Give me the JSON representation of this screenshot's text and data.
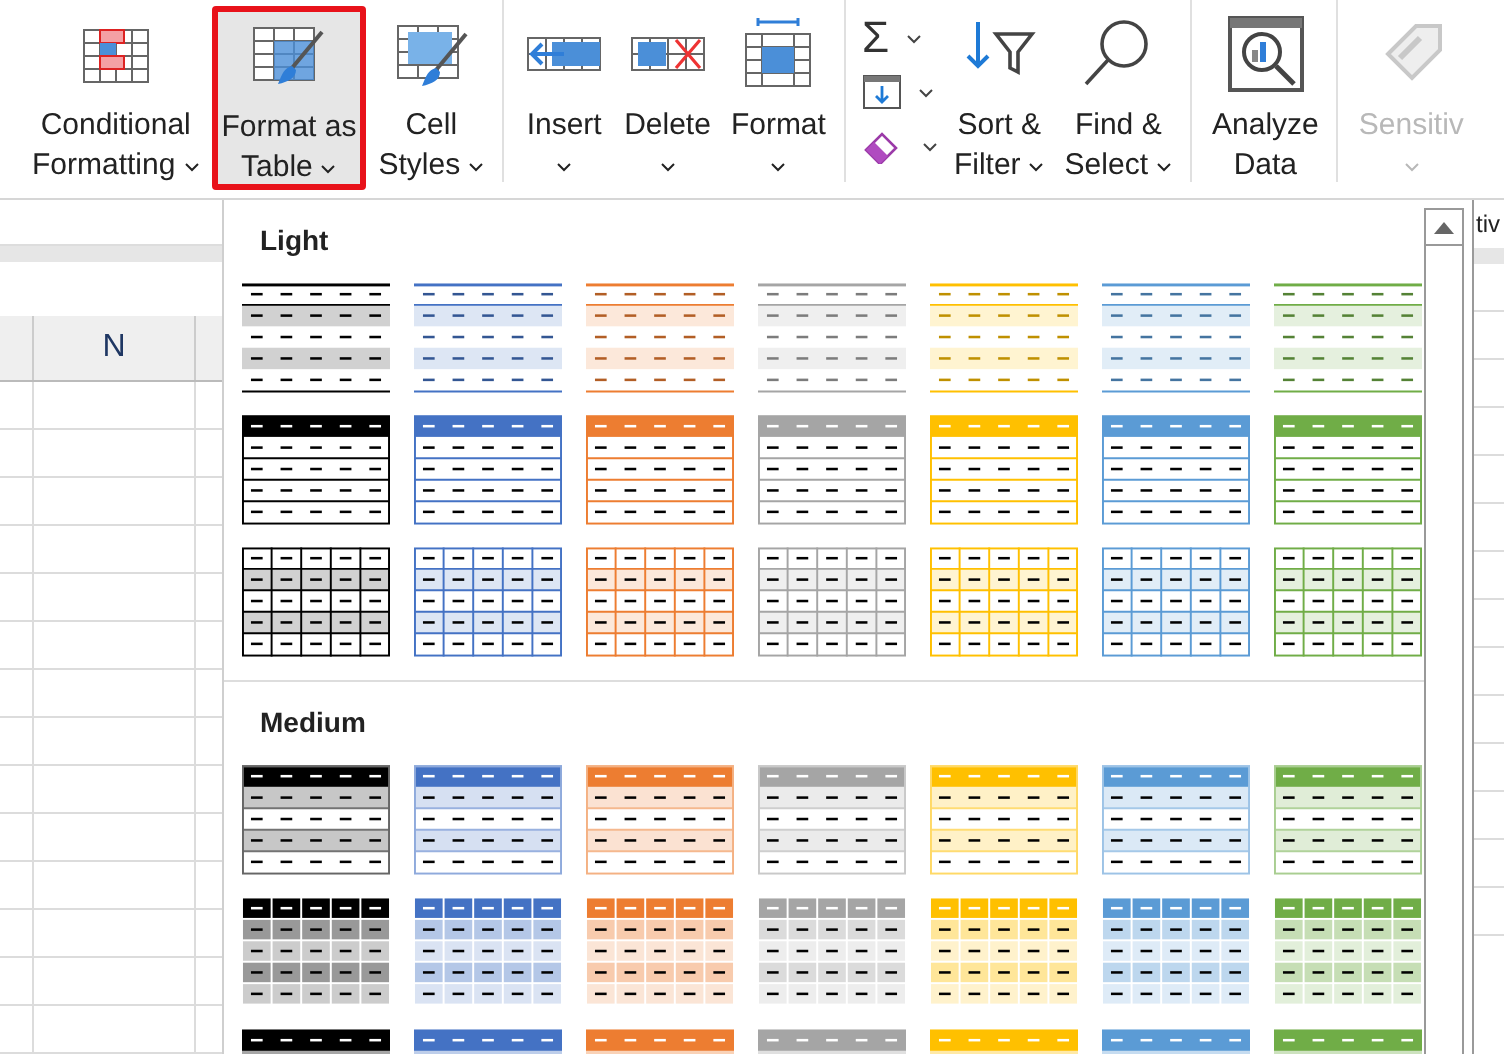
{
  "ribbon": {
    "groups": [
      {
        "buttons": [
          {
            "kind": "conditional-formatting",
            "lines": [
              "Conditional",
              "Formatting"
            ],
            "dropdown": true,
            "selected": false,
            "disabled": false
          },
          {
            "kind": "format-as-table",
            "lines": [
              "Format as",
              "Table"
            ],
            "dropdown": true,
            "selected": true,
            "disabled": false
          },
          {
            "kind": "cell-styles",
            "lines": [
              "Cell",
              "Styles"
            ],
            "dropdown": true,
            "selected": false,
            "disabled": false
          }
        ]
      },
      {
        "buttons": [
          {
            "kind": "insert",
            "lines": [
              "Insert"
            ],
            "dropdown": true,
            "selected": false,
            "disabled": false
          },
          {
            "kind": "delete",
            "lines": [
              "Delete"
            ],
            "dropdown": true,
            "selected": false,
            "disabled": false
          },
          {
            "kind": "format",
            "lines": [
              "Format"
            ],
            "dropdown": true,
            "selected": false,
            "disabled": false
          }
        ]
      },
      {
        "small_buttons": [
          {
            "kind": "autosum",
            "symbol": "Σ",
            "dropdown": true
          },
          {
            "kind": "fill",
            "dropdown": true
          },
          {
            "kind": "clear",
            "dropdown": true
          }
        ],
        "buttons": [
          {
            "kind": "sort-filter",
            "lines": [
              "Sort &",
              "Filter"
            ],
            "dropdown": true,
            "selected": false,
            "disabled": false
          },
          {
            "kind": "find-select",
            "lines": [
              "Find &",
              "Select"
            ],
            "dropdown": true,
            "selected": false,
            "disabled": false
          }
        ]
      },
      {
        "buttons": [
          {
            "kind": "analyze",
            "lines": [
              "Analyze",
              "Data"
            ],
            "dropdown": false,
            "selected": false,
            "disabled": false
          }
        ]
      },
      {
        "buttons": [
          {
            "kind": "sensitivity",
            "lines": [
              "Sensitiv"
            ],
            "dropdown": true,
            "selected": false,
            "disabled": true
          }
        ]
      }
    ]
  },
  "sheet": {
    "column_header": "N",
    "label_fragment": "tiv"
  },
  "gallery": {
    "sections": [
      {
        "title": "Light",
        "rows": [
          {
            "kind": "light-lines",
            "styles": [
              {
                "color": "#000000"
              },
              {
                "color": "#4472c4"
              },
              {
                "color": "#ed7d31"
              },
              {
                "color": "#a5a5a5"
              },
              {
                "color": "#ffc000"
              },
              {
                "color": "#5b9bd5"
              },
              {
                "color": "#70ad47"
              }
            ]
          },
          {
            "kind": "light-header",
            "styles": [
              {
                "color": "#000000"
              },
              {
                "color": "#4472c4"
              },
              {
                "color": "#ed7d31"
              },
              {
                "color": "#a5a5a5"
              },
              {
                "color": "#ffc000"
              },
              {
                "color": "#5b9bd5"
              },
              {
                "color": "#70ad47"
              }
            ]
          },
          {
            "kind": "light-grid",
            "styles": [
              {
                "color": "#000000"
              },
              {
                "color": "#4472c4"
              },
              {
                "color": "#ed7d31"
              },
              {
                "color": "#a5a5a5"
              },
              {
                "color": "#ffc000"
              },
              {
                "color": "#5b9bd5"
              },
              {
                "color": "#70ad47"
              }
            ]
          }
        ]
      },
      {
        "title": "Medium",
        "rows": [
          {
            "kind": "medium-banded",
            "styles": [
              {
                "color": "#000000"
              },
              {
                "color": "#4472c4"
              },
              {
                "color": "#ed7d31"
              },
              {
                "color": "#a5a5a5"
              },
              {
                "color": "#ffc000"
              },
              {
                "color": "#5b9bd5"
              },
              {
                "color": "#70ad47"
              }
            ]
          },
          {
            "kind": "medium-grid",
            "styles": [
              {
                "color": "#000000"
              },
              {
                "color": "#4472c4"
              },
              {
                "color": "#ed7d31"
              },
              {
                "color": "#a5a5a5"
              },
              {
                "color": "#ffc000"
              },
              {
                "color": "#5b9bd5"
              },
              {
                "color": "#70ad47"
              }
            ]
          },
          {
            "kind": "medium-solid",
            "styles": [
              {
                "color": "#000000"
              },
              {
                "color": "#4472c4"
              },
              {
                "color": "#ed7d31"
              },
              {
                "color": "#a5a5a5"
              },
              {
                "color": "#ffc000"
              },
              {
                "color": "#5b9bd5"
              },
              {
                "color": "#70ad47"
              }
            ]
          }
        ]
      }
    ]
  }
}
